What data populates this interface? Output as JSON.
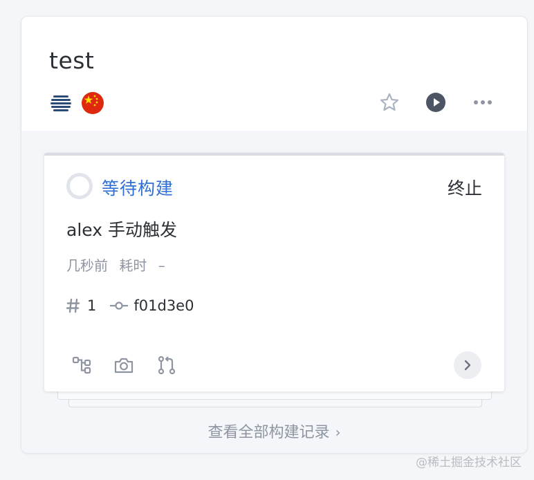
{
  "pipeline": {
    "title": "test",
    "badges": [
      "stripe-logo-icon",
      "china-flag-icon"
    ],
    "actions": [
      "star-icon",
      "play-icon",
      "more-icon"
    ]
  },
  "build": {
    "status": "等待构建",
    "terminate_label": "终止",
    "trigger": "alex 手动触发",
    "time_ago": "几秒前",
    "duration_label": "耗时",
    "duration_value": "–",
    "number": "1",
    "commit": "f01d3e0",
    "tools": [
      "flow-icon",
      "camera-icon",
      "pull-request-icon"
    ]
  },
  "view_all_label": "查看全部构建记录",
  "watermark": "@稀土掘金技术社区",
  "colors": {
    "status_blue": "#2f6fd6",
    "text": "#2b2f36",
    "muted": "#8e95a1",
    "play_button": "#4b5563"
  }
}
